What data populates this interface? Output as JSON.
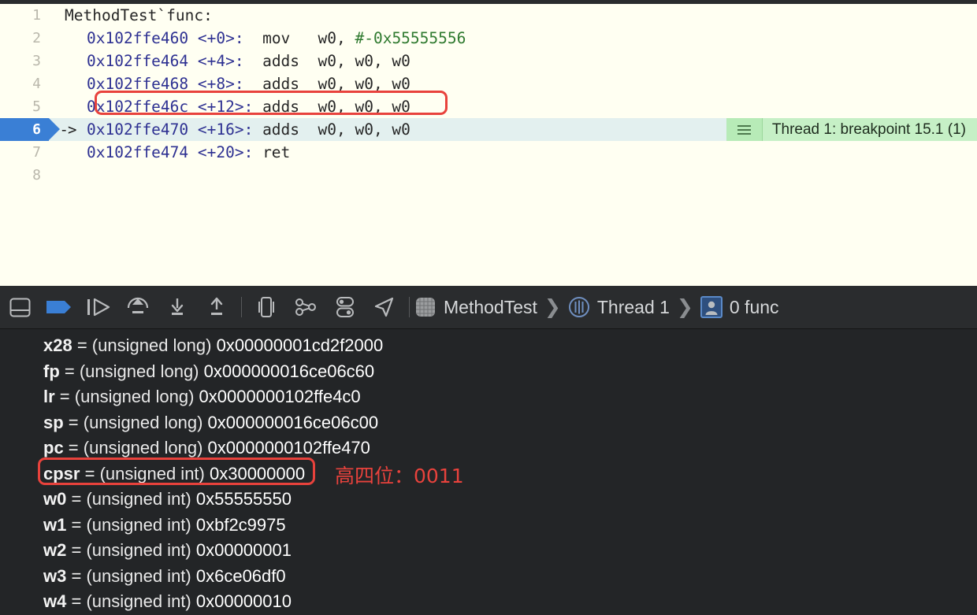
{
  "editor": {
    "lines": [
      {
        "num": "1",
        "arrow": "",
        "indent": 0,
        "parts": [
          {
            "t": "MethodTest`func:",
            "c": "plain"
          }
        ]
      },
      {
        "num": "2",
        "arrow": "",
        "indent": 1,
        "parts": [
          {
            "t": "0x102ffe460 <+0>:",
            "c": "addr"
          },
          {
            "t": "  mov   w0, ",
            "c": "plain"
          },
          {
            "t": "#-0x55555556",
            "c": "imm"
          }
        ]
      },
      {
        "num": "3",
        "arrow": "",
        "indent": 1,
        "parts": [
          {
            "t": "0x102ffe464 <+4>:",
            "c": "addr"
          },
          {
            "t": "  adds  w0, w0, w0",
            "c": "plain"
          }
        ]
      },
      {
        "num": "4",
        "arrow": "",
        "indent": 1,
        "parts": [
          {
            "t": "0x102ffe468 <+8>:",
            "c": "addr"
          },
          {
            "t": "  adds  w0, w0, w0",
            "c": "plain"
          }
        ]
      },
      {
        "num": "5",
        "arrow": "",
        "indent": 1,
        "parts": [
          {
            "t": "0x102ffe46c <+12>:",
            "c": "addr"
          },
          {
            "t": " adds  w0, w0, w0",
            "c": "plain"
          }
        ]
      },
      {
        "num": "6",
        "arrow": "->",
        "indent": 1,
        "parts": [
          {
            "t": "0x102ffe470 <+16>:",
            "c": "addr"
          },
          {
            "t": " adds  w0, w0, w0",
            "c": "plain"
          }
        ]
      },
      {
        "num": "7",
        "arrow": "",
        "indent": 1,
        "parts": [
          {
            "t": "0x102ffe474 <+20>:",
            "c": "addr"
          },
          {
            "t": " ret",
            "c": "plain"
          }
        ]
      },
      {
        "num": "8",
        "arrow": "",
        "indent": 0,
        "parts": []
      }
    ],
    "current_line_index": 5,
    "breakpoint_annotation": "Thread 1: breakpoint 15.1 (1)",
    "highlight_box_line": "0x102ffe46c <+12>: adds  w0, w0, w0"
  },
  "toolbar": {
    "icons": [
      "hide-debug-area-icon",
      "breakpoint-flag-icon",
      "continue-icon",
      "step-over-icon",
      "step-into-icon",
      "step-out-icon",
      "view-debugging-icon",
      "memory-graph-icon",
      "environment-overrides-icon",
      "simulate-location-icon"
    ],
    "breadcrumb": [
      {
        "icon": "process-icon",
        "label": "MethodTest"
      },
      {
        "icon": "thread-icon",
        "label": "Thread 1"
      },
      {
        "icon": "frame-icon",
        "label": "0 func"
      }
    ],
    "breadcrumb_separator": "❯"
  },
  "variables": {
    "rows": [
      {
        "name": "x28",
        "type": "(unsigned long)",
        "value": "0x00000001cd2f2000"
      },
      {
        "name": "fp",
        "type": "(unsigned long)",
        "value": "0x000000016ce06c60"
      },
      {
        "name": "lr",
        "type": "(unsigned long)",
        "value": "0x0000000102ffe4c0"
      },
      {
        "name": "sp",
        "type": "(unsigned long)",
        "value": "0x000000016ce06c00"
      },
      {
        "name": "pc",
        "type": "(unsigned long)",
        "value": "0x0000000102ffe470"
      },
      {
        "name": "cpsr",
        "type": "(unsigned int)",
        "value": "0x30000000"
      },
      {
        "name": "w0",
        "type": "(unsigned int)",
        "value": "0x55555550"
      },
      {
        "name": "w1",
        "type": "(unsigned int)",
        "value": "0xbf2c9975"
      },
      {
        "name": "w2",
        "type": "(unsigned int)",
        "value": "0x00000001"
      },
      {
        "name": "w3",
        "type": "(unsigned int)",
        "value": "0x6ce06df0"
      },
      {
        "name": "w4",
        "type": "(unsigned int)",
        "value": "0x00000010"
      }
    ],
    "equals": " = "
  },
  "annotations": {
    "cn_note": "高四位：0011",
    "box_color": "#e8423c"
  },
  "colors": {
    "editor_bg": "#fffff2",
    "panel_bg": "#232527",
    "toolbar_bg": "#2a2c2e",
    "address": "#2e3192",
    "immediate": "#2f7a2f",
    "current_line_bg": "#e3f0ef",
    "pc_badge": "#3a7fd5",
    "breakpoint_badge": "#c6f0c6",
    "annotation_red": "#e8423c"
  }
}
